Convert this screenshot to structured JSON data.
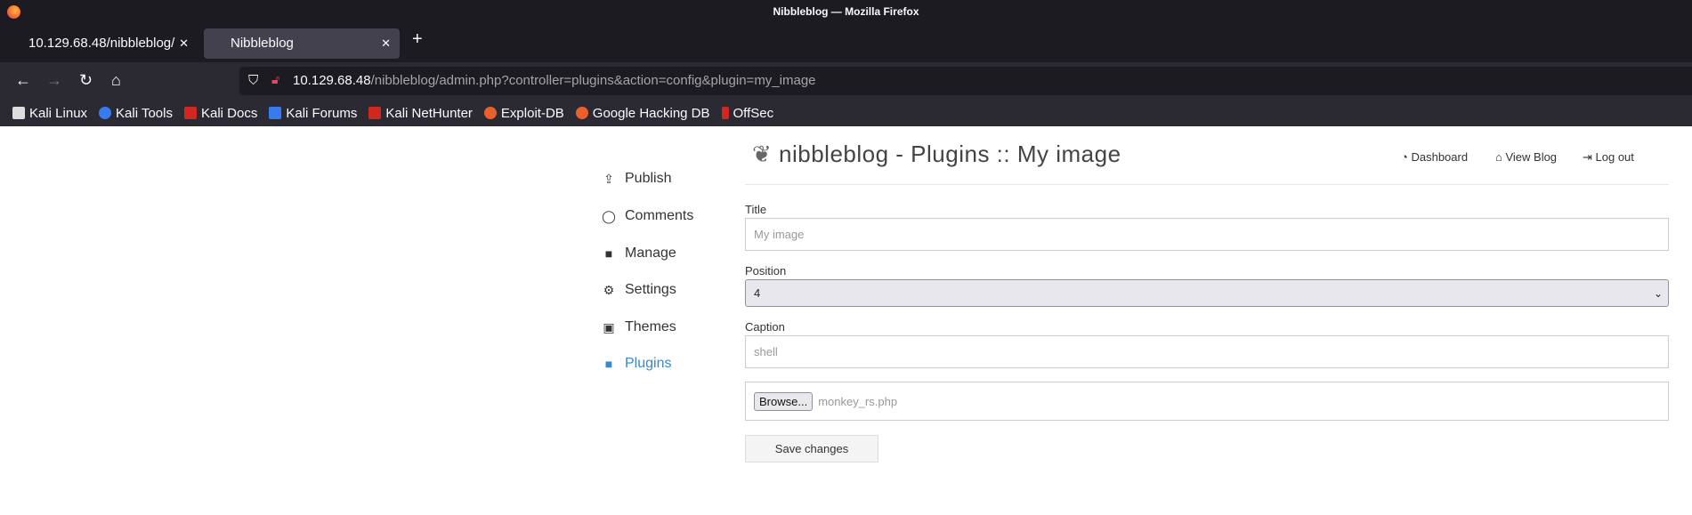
{
  "window": {
    "title": "Nibbleblog — Mozilla Firefox"
  },
  "tabs": [
    {
      "label": "10.129.68.48/nibbleblog/"
    },
    {
      "label": "Nibbleblog"
    }
  ],
  "url": {
    "host": "10.129.68.48",
    "path": "/nibbleblog/admin.php?controller=plugins&action=config&plugin=my_image"
  },
  "bookmarks": [
    {
      "label": "Kali Linux",
      "color": "#dddddd"
    },
    {
      "label": "Kali Tools",
      "color": "#367bf0"
    },
    {
      "label": "Kali Docs",
      "color": "#d0281f"
    },
    {
      "label": "Kali Forums",
      "color": "#367bf0"
    },
    {
      "label": "Kali NetHunter",
      "color": "#d0281f"
    },
    {
      "label": "Exploit-DB",
      "color": "#e8602c"
    },
    {
      "label": "Google Hacking DB",
      "color": "#e8602c"
    },
    {
      "label": "OffSec",
      "color": "#d0281f"
    }
  ],
  "sidebar": [
    {
      "label": "Publish",
      "icon": "publish-icon"
    },
    {
      "label": "Comments",
      "icon": "comment-icon"
    },
    {
      "label": "Manage",
      "icon": "folder-icon"
    },
    {
      "label": "Settings",
      "icon": "gear-icon"
    },
    {
      "label": "Themes",
      "icon": "image-icon"
    },
    {
      "label": "Plugins",
      "icon": "folder-open-icon",
      "active": true
    }
  ],
  "header": {
    "title": "nibbleblog - Plugins :: My image",
    "links": [
      "Dashboard",
      "View Blog",
      "Log out"
    ]
  },
  "form": {
    "title_label": "Title",
    "title_placeholder": "My image",
    "position_label": "Position",
    "position_value": "4",
    "caption_label": "Caption",
    "caption_placeholder": "shell",
    "browse_label": "Browse...",
    "file_name": "monkey_rs.php",
    "save_label": "Save changes"
  },
  "accent_color": "#3a87c9"
}
